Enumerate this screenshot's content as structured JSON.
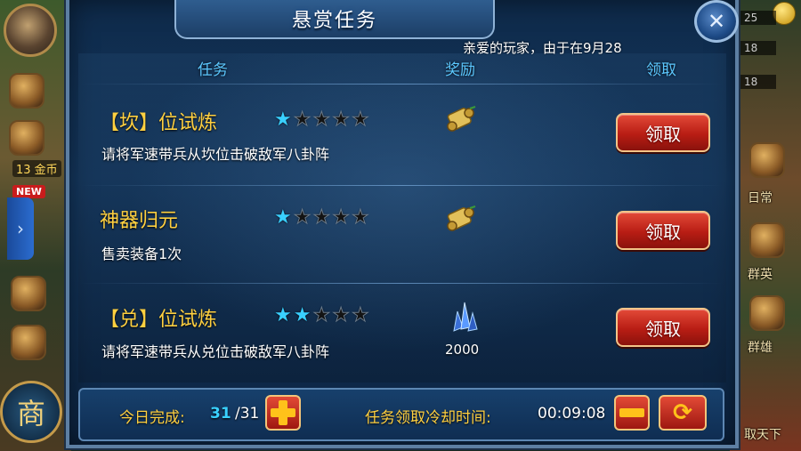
{
  "dialog": {
    "title": "悬赏任务",
    "marquee": "亲爱的玩家，由于在9月28",
    "close_icon": "crossed-swords-icon"
  },
  "columns": {
    "task": "任务",
    "reward": "奖励",
    "claim": "领取"
  },
  "tasks": [
    {
      "name": "【坎】位试炼",
      "description": "请将军速带兵从坎位击破敌军八卦阵",
      "stars_filled": 1,
      "stars_total": 5,
      "reward_icon": "scroll-icon",
      "reward_qty": "",
      "claim_label": "领取"
    },
    {
      "name": "神器归元",
      "description": "售卖装备1次",
      "stars_filled": 1,
      "stars_total": 5,
      "reward_icon": "scroll-icon",
      "reward_qty": "",
      "claim_label": "领取"
    },
    {
      "name": "【兑】位试炼",
      "description": "请将军速带兵从兑位击破敌军八卦阵",
      "stars_filled": 2,
      "stars_total": 5,
      "reward_icon": "blue-crystal-icon",
      "reward_qty": "2000",
      "claim_label": "领取"
    }
  ],
  "footer": {
    "completed_label": "今日完成:",
    "completed_count": "31",
    "completed_total": "/31",
    "cooldown_label": "任务领取冷却时间:",
    "cooldown_time": "00:09:08"
  },
  "background_hud": {
    "gold_badge": "13 金币",
    "new_badge": "NEW",
    "shop_glyph": "商",
    "level_top": "25",
    "level_mid": "18",
    "level_low": "18",
    "right_label_1": "日常",
    "right_label_2": "群雄",
    "right_label_3": "群英",
    "right_label_4": "取天下"
  },
  "colors": {
    "panel_blue": "#14375e",
    "task_name_gold": "#ffd040",
    "column_head_cyan": "#5cc8ff",
    "star_on": "#39d0ff",
    "claim_red": "#b81d14",
    "footer_count_cyan": "#39d0ff"
  }
}
